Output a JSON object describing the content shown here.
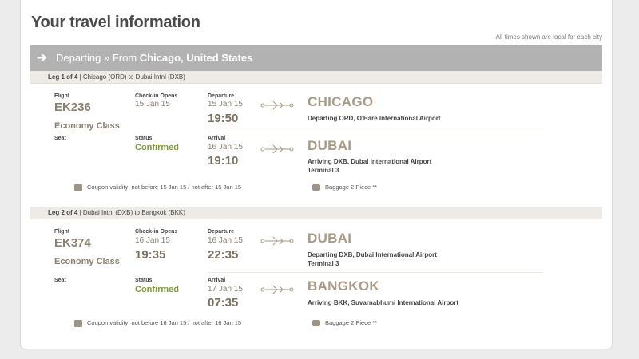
{
  "page": {
    "title": "Your travel information",
    "note": "All times shown are local for each city"
  },
  "departing": {
    "prefix": "Departing » From ",
    "city": "Chicago, United States"
  },
  "legs": [
    {
      "header_prefix": "Leg 1 of 4",
      "header_route": " | Chicago (ORD) to Dubai Intnl (DXB)",
      "flight_label": "Flight",
      "flight_no": "EK236",
      "class": "Economy Class",
      "checkin_label": "Check-in Opens",
      "checkin_date": "15 Jan 15",
      "checkin_time": "",
      "departure_label": "Departure",
      "departure_date": "15 Jan 15",
      "departure_time": "19:50",
      "from_city": "CHICAGO",
      "from_airport": "Departing ORD, O'Hare International Airport",
      "from_terminal": "",
      "seat_label": "Seat",
      "status_label": "Status",
      "status": "Confirmed",
      "arrival_label": "Arrival",
      "arrival_date": "16 Jan 15",
      "arrival_time": "19:10",
      "to_city": "DUBAI",
      "to_airport": "Arriving DXB, Dubai International Airport",
      "to_terminal": "Terminal 3",
      "coupon": "Coupon validity: not before 15 Jan 15 / not after 15 Jan 15",
      "baggage": "Baggage 2 Piece **"
    },
    {
      "header_prefix": "Leg 2 of 4",
      "header_route": " | Dubai Intnl (DXB) to Bangkok (BKK)",
      "flight_label": "Flight",
      "flight_no": "EK374",
      "class": "Economy Class",
      "checkin_label": "Check-in Opens",
      "checkin_date": "16 Jan 15",
      "checkin_time": "19:35",
      "departure_label": "Departure",
      "departure_date": "16 Jan 15",
      "departure_time": "22:35",
      "from_city": "DUBAI",
      "from_airport": "Departing DXB, Dubai International Airport",
      "from_terminal": "Terminal 3",
      "seat_label": "Seat",
      "status_label": "Status",
      "status": "Confirmed",
      "arrival_label": "Arrival",
      "arrival_date": "17 Jan 15",
      "arrival_time": "07:35",
      "to_city": "BANGKOK",
      "to_airport": "Arriving BKK, Suvarnabhumi International Airport",
      "to_terminal": "",
      "coupon": "Coupon validity: not before 16 Jan 15 / not after 16 Jan 15",
      "baggage": "Baggage 2 Piece **"
    }
  ],
  "colors": {
    "header_bar": "#b2b2b2",
    "status": "#7d9a3d",
    "accent_text": "#8b8070"
  }
}
